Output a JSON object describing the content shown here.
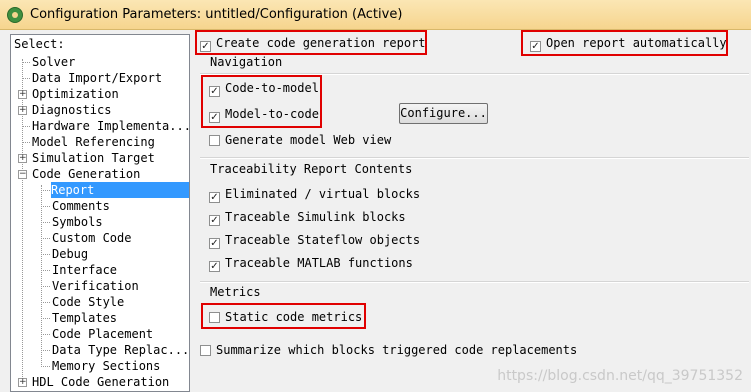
{
  "window": {
    "title": "Configuration Parameters: untitled/Configuration (Active)"
  },
  "tree": {
    "header": "Select:",
    "items": {
      "solver": "Solver",
      "data_import": "Data Import/Export",
      "optimization": "Optimization",
      "diagnostics": "Diagnostics",
      "hardware": "Hardware Implementa...",
      "model_ref": "Model Referencing",
      "sim_target": "Simulation Target",
      "code_gen": "Code Generation",
      "report": "Report",
      "comments": "Comments",
      "symbols": "Symbols",
      "custom_code": "Custom Code",
      "debug": "Debug",
      "interface": "Interface",
      "verification": "Verification",
      "code_style": "Code Style",
      "templates": "Templates",
      "code_placement": "Code Placement",
      "data_type_repl": "Data Type Replac...",
      "memory_sections": "Memory Sections",
      "hdl_code_gen": "HDL Code Generation"
    },
    "selected": "Report"
  },
  "options": {
    "create_report": {
      "label": "Create code generation report",
      "checked": true
    },
    "open_report": {
      "label": "Open report automatically",
      "checked": true
    },
    "navigation": {
      "title": "Navigation",
      "code_to_model": {
        "label": "Code-to-model",
        "checked": true
      },
      "model_to_code": {
        "label": "Model-to-code",
        "checked": true
      },
      "configure_button": "Configure...",
      "web_view": {
        "label": "Generate model Web view",
        "checked": false
      }
    },
    "traceability": {
      "title": "Traceability Report Contents",
      "eliminated": {
        "label": "Eliminated / virtual blocks",
        "checked": true
      },
      "simulink": {
        "label": "Traceable Simulink blocks",
        "checked": true
      },
      "stateflow": {
        "label": "Traceable Stateflow objects",
        "checked": true
      },
      "matlab": {
        "label": "Traceable MATLAB functions",
        "checked": true
      }
    },
    "metrics": {
      "title": "Metrics",
      "static_metrics": {
        "label": "Static code metrics",
        "checked": false
      }
    },
    "summarize": {
      "label": "Summarize which blocks triggered code replacements",
      "checked": false
    }
  },
  "watermark": "https://blog.csdn.net/qq_39751352",
  "colors": {
    "highlight": "#e00000",
    "selection": "#3399ff",
    "titlebar": "#f6d58e"
  }
}
